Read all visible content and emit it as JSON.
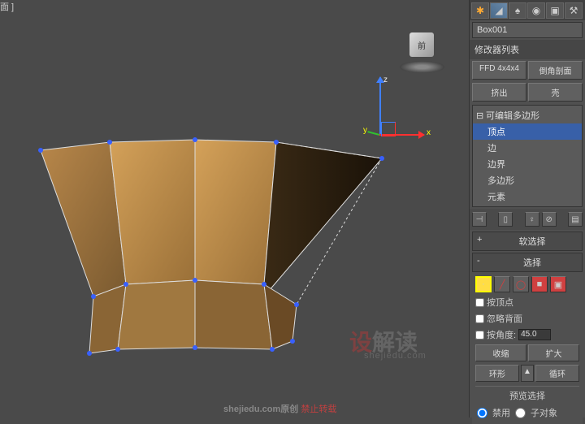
{
  "viewport": {
    "label": "面 ]",
    "cube_face": "前"
  },
  "gizmo": {
    "z": "z",
    "x": "x",
    "y": "y"
  },
  "panel": {
    "object_name": "Box001",
    "modifier_list_label": "修改器列表",
    "mod_buttons": {
      "ffd": "FFD 4x4x4",
      "chamfer": "倒角剖面",
      "extrude": "挤出",
      "shell": "壳"
    },
    "tree": {
      "root": "可编辑多边形",
      "items": [
        "顶点",
        "边",
        "边界",
        "多边形",
        "元素"
      ]
    },
    "icons": {
      "pin": "⊣",
      "stack1": "▯",
      "stack2": "▯",
      "bulb": "♀",
      "trash": "⊘",
      "cfg": "▤"
    }
  },
  "rollouts": {
    "softsel": {
      "toggle": "+",
      "title": "软选择"
    },
    "selection": {
      "toggle": "-",
      "title": "选择",
      "by_vertex": "按顶点",
      "ignore_backface": "忽略背面",
      "by_angle": "按角度:",
      "angle_value": "45.0",
      "shrink": "收缩",
      "grow": "扩大",
      "ring": "环形",
      "loop": "循环",
      "preview_label": "预览选择",
      "preview_off": "禁用",
      "preview_subobj": "子对象"
    }
  },
  "watermark": {
    "brand_a": "设",
    "brand_b": "解读",
    "url": "shejiedu.com"
  },
  "footer": {
    "site": "shejiedu.com原创 ",
    "warn": "禁止转载"
  }
}
